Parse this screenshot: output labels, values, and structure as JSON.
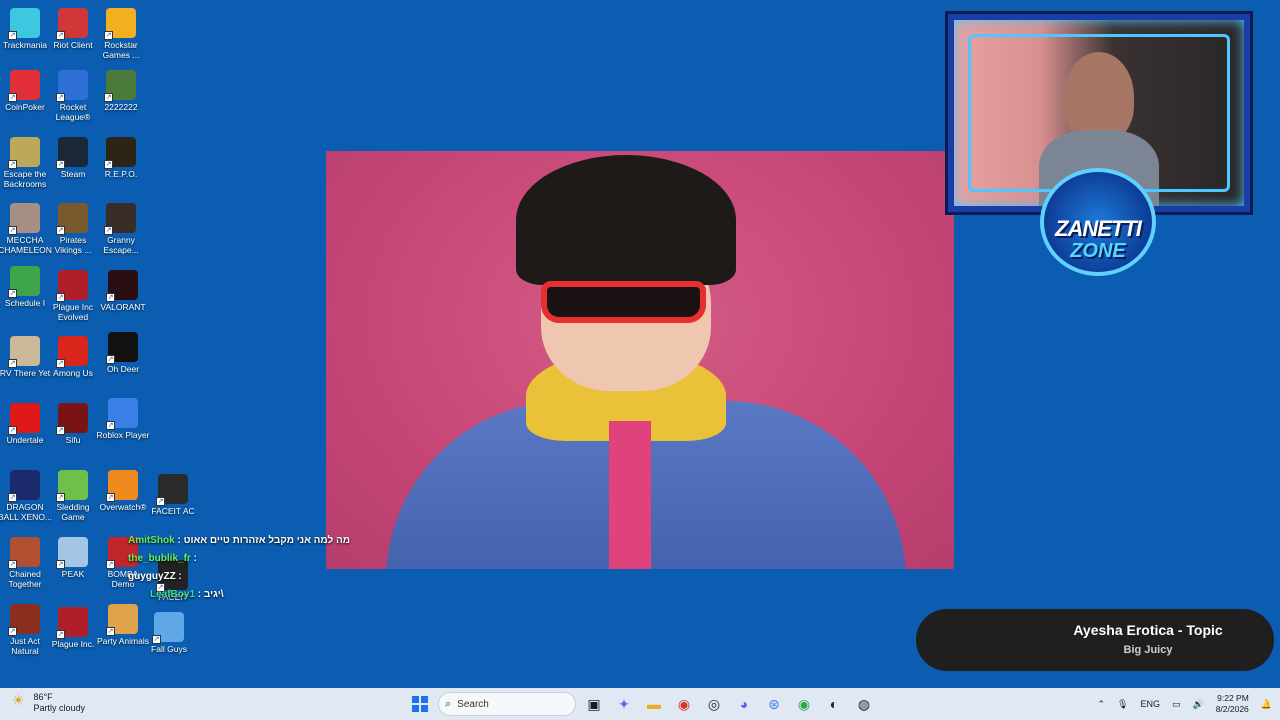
{
  "desktop_icons": [
    {
      "label": "Trackmania",
      "icon": "trackmania-icon",
      "color": "#3ec7e0"
    },
    {
      "label": "Riot Client",
      "icon": "riot-icon",
      "color": "#d13639"
    },
    {
      "label": "Rockstar Games ...",
      "icon": "rockstar-icon",
      "color": "#f2b01e"
    },
    {
      "label": "CoinPoker",
      "icon": "coinpoker-icon",
      "color": "#e2303a"
    },
    {
      "label": "Rocket League®",
      "icon": "rocket-league-icon",
      "color": "#2e6fd8"
    },
    {
      "label": "2222222",
      "icon": "game-icon",
      "color": "#4c7a3a"
    },
    {
      "label": "Escape the Backrooms",
      "icon": "backrooms-icon",
      "color": "#bda85a"
    },
    {
      "label": "Steam",
      "icon": "steam-icon",
      "color": "#1b2838"
    },
    {
      "label": "R.E.P.O.",
      "icon": "repo-icon",
      "color": "#2c2414"
    },
    {
      "label": "MECCHA CHAMELEON",
      "icon": "chameleon-icon",
      "color": "#a88f86"
    },
    {
      "label": "Pirates Vikings ...",
      "icon": "pirates-icon",
      "color": "#7a5a2c"
    },
    {
      "label": "Granny Escape...",
      "icon": "granny-icon",
      "color": "#3a2c26"
    },
    {
      "label": "Schedule I",
      "icon": "schedule-icon",
      "color": "#3ea44a"
    },
    {
      "label": "Plague Inc Evolved",
      "icon": "plague-icon",
      "color": "#b01e28"
    },
    {
      "label": "VALORANT",
      "icon": "valorant-icon",
      "color": "#2a0e14"
    },
    {
      "label": "RV There Yet",
      "icon": "rv-icon",
      "color": "#c9b89a"
    },
    {
      "label": "Among Us",
      "icon": "among-us-icon",
      "color": "#d9261c"
    },
    {
      "label": "Oh Deer",
      "icon": "oh-deer-icon",
      "color": "#111111"
    },
    {
      "label": "Undertale",
      "icon": "undertale-icon",
      "color": "#e01818"
    },
    {
      "label": "Sifu",
      "icon": "sifu-icon",
      "color": "#7a1414"
    },
    {
      "label": "Roblox Player",
      "icon": "roblox-icon",
      "color": "#3a7ee8"
    },
    {
      "label": "DRAGON BALL XENO...",
      "icon": "dragonball-icon",
      "color": "#1a2a6c"
    },
    {
      "label": "Sledding Game",
      "icon": "sledding-icon",
      "color": "#6dc04a"
    },
    {
      "label": "Overwatch®",
      "icon": "overwatch-icon",
      "color": "#f08a1e"
    },
    {
      "label": "FACEIT AC",
      "icon": "faceit-icon",
      "color": "#2a2a2a"
    },
    {
      "label": "Chained Together",
      "icon": "chained-icon",
      "color": "#b05030"
    },
    {
      "label": "PEAK",
      "icon": "peak-icon",
      "color": "#a4c6e6"
    },
    {
      "label": "BOMBA Demo",
      "icon": "bomba-icon",
      "color": "#c0262a"
    },
    {
      "label": "FACEIT",
      "icon": "faceit-app-icon",
      "color": "#222222"
    },
    {
      "label": "Just Act Natural",
      "icon": "just-act-icon",
      "color": "#8a2e1e"
    },
    {
      "label": "Plague Inc.",
      "icon": "plague-inc-icon",
      "color": "#b01e28"
    },
    {
      "label": "Party Animals",
      "icon": "party-animals-icon",
      "color": "#e0a24a"
    },
    {
      "label": "Fall Guys",
      "icon": "fall-guys-icon",
      "color": "#5ea8e8"
    }
  ],
  "chat": [
    {
      "user": "AmitShok",
      "sep": " : ",
      "text": "מה למה אני מקבל אזהרות טיים אאוט"
    },
    {
      "user": "the_bublik_fr",
      "sep": " : ",
      "text": ""
    },
    {
      "user": "guyguyZZ",
      "sep": " : ",
      "text": ""
    },
    {
      "user": "LeafBoy1",
      "sep": " : ",
      "text": "יגיב\\"
    }
  ],
  "webcam": {
    "logo_line1": "ZANETTI",
    "logo_line2": "ZONE"
  },
  "now_playing": {
    "title": "Ayesha Erotica - Topic",
    "subtitle": "Big Juicy"
  },
  "taskbar": {
    "weather_temp": "86°F",
    "weather_desc": "Partly cloudy",
    "search_placeholder": "Search",
    "lang": "ENG",
    "time": "9:22 PM",
    "date": "8/2/2026"
  }
}
